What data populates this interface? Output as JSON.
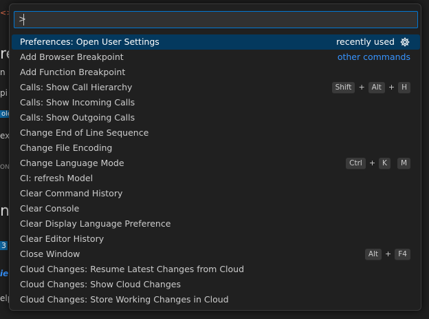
{
  "background": {
    "fragments": [
      "<>",
      "re",
      "n",
      "pi",
      "ole",
      "ext",
      "ON",
      "np",
      "3",
      "ie",
      "elp"
    ]
  },
  "palette": {
    "input_value": ">",
    "items": [
      {
        "label": "Preferences: Open User Settings",
        "meta": "recently used",
        "meta_icon": "gear-icon",
        "selected": true
      },
      {
        "label": "Add Browser Breakpoint",
        "link": "other commands"
      },
      {
        "label": "Add Function Breakpoint"
      },
      {
        "label": "Calls: Show Call Hierarchy",
        "keys": [
          "Shift",
          "Alt",
          "H"
        ]
      },
      {
        "label": "Calls: Show Incoming Calls"
      },
      {
        "label": "Calls: Show Outgoing Calls"
      },
      {
        "label": "Change End of Line Sequence"
      },
      {
        "label": "Change File Encoding"
      },
      {
        "label": "Change Language Mode",
        "keys": [
          "Ctrl",
          "K"
        ],
        "chord": [
          "M"
        ]
      },
      {
        "label": "CI: refresh Model"
      },
      {
        "label": "Clear Command History"
      },
      {
        "label": "Clear Console"
      },
      {
        "label": "Clear Display Language Preference"
      },
      {
        "label": "Clear Editor History"
      },
      {
        "label": "Close Window",
        "keys": [
          "Alt",
          "F4"
        ]
      },
      {
        "label": "Cloud Changes: Resume Latest Changes from Cloud"
      },
      {
        "label": "Cloud Changes: Show Cloud Changes"
      },
      {
        "label": "Cloud Changes: Store Working Changes in Cloud"
      }
    ],
    "plus_sign": "+"
  },
  "colors": {
    "accent": "#0078d4",
    "selection": "#04395e",
    "link": "#3794ff"
  }
}
